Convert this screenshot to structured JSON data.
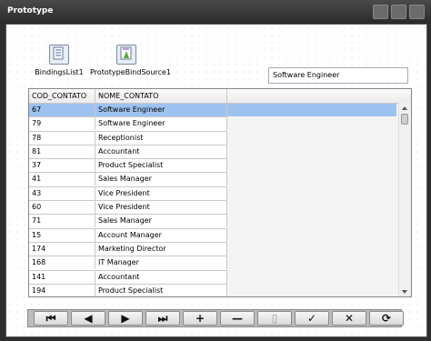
{
  "window": {
    "title": "Prototype"
  },
  "components": [
    {
      "name": "BindingsList1",
      "icon": "bindings-list-icon"
    },
    {
      "name": "PrototypeBindSource1",
      "icon": "bind-source-icon"
    }
  ],
  "textbox": {
    "value": "Software Engineer"
  },
  "grid": {
    "columns": [
      "COD_CONTATO",
      "NOME_CONTATO"
    ],
    "rows": [
      [
        "67",
        "Software Engineer"
      ],
      [
        "79",
        "Software Engineer"
      ],
      [
        "78",
        "Receptionist"
      ],
      [
        "81",
        "Accountant"
      ],
      [
        "37",
        "Product Specialist"
      ],
      [
        "41",
        "Sales Manager"
      ],
      [
        "43",
        "Vice President"
      ],
      [
        "60",
        "Vice President"
      ],
      [
        "71",
        "Sales Manager"
      ],
      [
        "15",
        "Account Manager"
      ],
      [
        "174",
        "Marketing Director"
      ],
      [
        "168",
        "IT Manager"
      ],
      [
        "141",
        "Accountant"
      ],
      [
        "194",
        "Product Specialist"
      ]
    ],
    "selected_row": 0
  },
  "navigator": {
    "buttons": [
      {
        "name": "first-record",
        "glyph": "⏮"
      },
      {
        "name": "prior-record",
        "glyph": "◀"
      },
      {
        "name": "next-record",
        "glyph": "▶"
      },
      {
        "name": "last-record",
        "glyph": "⏭"
      },
      {
        "name": "insert-record",
        "glyph": "+"
      },
      {
        "name": "delete-record",
        "glyph": "—"
      },
      {
        "name": "edit-record",
        "glyph": "▯"
      },
      {
        "name": "post-record",
        "glyph": "✓"
      },
      {
        "name": "cancel-edit",
        "glyph": "✕"
      },
      {
        "name": "refresh",
        "glyph": "⟳"
      }
    ]
  },
  "colors": {
    "selection": "#9ec2ef",
    "titlebar": "#3a3a3a"
  }
}
